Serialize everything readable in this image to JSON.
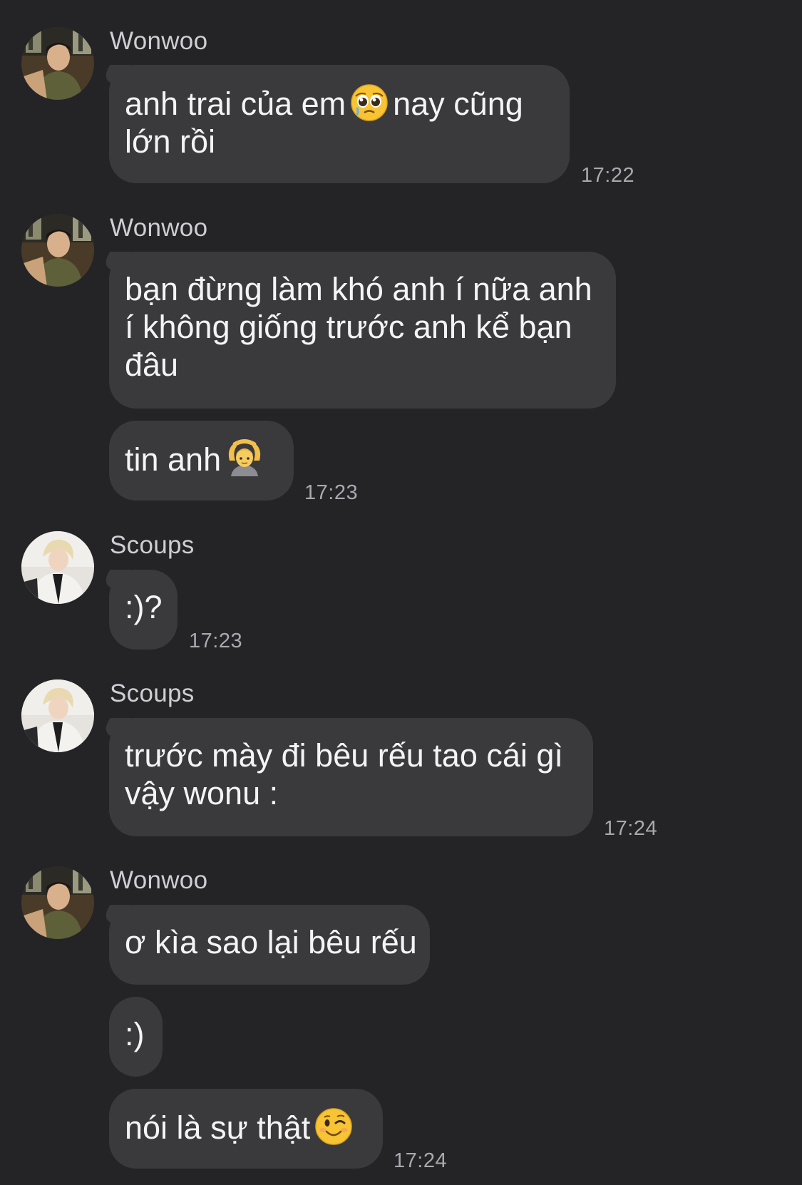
{
  "colors": {
    "background": "#242427",
    "bubble": "#3a3a3d",
    "text": "#f4f4f6",
    "sender": "#cfcfd3",
    "timestamp": "#a9a9ae"
  },
  "messages": [
    {
      "sender": "Wonwoo",
      "bubbles": [
        {
          "lines": [
            "anh trai của em",
            "nay cũng",
            "lớn rồi"
          ],
          "emoji": "pleading-face-emoji"
        }
      ],
      "time": "17:22"
    },
    {
      "sender": "Wonwoo",
      "bubbles": [
        {
          "lines": [
            "bạn đừng làm khó anh í nữa anh",
            "í không giống trước anh kể bạn",
            "đâu"
          ]
        },
        {
          "lines": [
            "tin anh"
          ],
          "emoji": "person-gesturing-ok-emoji"
        }
      ],
      "time": "17:23"
    },
    {
      "sender": "Scoups",
      "bubbles": [
        {
          "lines": [
            ":)?"
          ]
        }
      ],
      "time": "17:23"
    },
    {
      "sender": "Scoups",
      "bubbles": [
        {
          "lines": [
            "trước mày đi bêu rếu tao cái gì",
            "vậy wonu :"
          ]
        }
      ],
      "time": "17:24"
    },
    {
      "sender": "Wonwoo",
      "bubbles": [
        {
          "lines": [
            "ơ kìa sao lại bêu rếu"
          ]
        },
        {
          "lines": [
            ":)"
          ]
        },
        {
          "lines": [
            "nói là sự thật"
          ],
          "emoji": "winking-face-emoji"
        }
      ],
      "time": "17:24"
    }
  ]
}
